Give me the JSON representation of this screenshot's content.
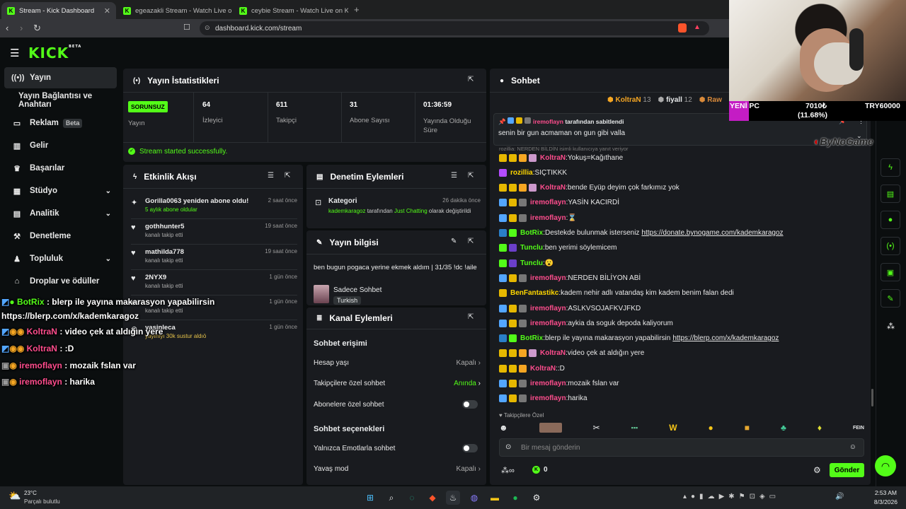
{
  "browser": {
    "tabs": [
      {
        "title": "Stream - Kick Dashboard"
      },
      {
        "title": "egeazakli Stream - Watch Live on"
      },
      {
        "title": "ceybie Stream - Watch Live on K"
      }
    ],
    "url": "dashboard.kick.com/stream"
  },
  "kick": {
    "logo": "KICK",
    "logo_badge": "BETA"
  },
  "sidebar": {
    "items": [
      {
        "label": "Yayın",
        "icon": "broadcast-icon"
      },
      {
        "label": "Yayın Bağlantısı ve Anahtarı"
      },
      {
        "label": "Reklam",
        "badge": "Beta",
        "icon": "tv-icon"
      },
      {
        "label": "Gelir",
        "icon": "chart-icon"
      },
      {
        "label": "Başarılar",
        "icon": "trophy-icon"
      },
      {
        "label": "Stüdyo",
        "icon": "grid-icon"
      },
      {
        "label": "Analitik",
        "icon": "analytics-icon"
      },
      {
        "label": "Denetleme",
        "icon": "hammer-icon"
      },
      {
        "label": "Topluluk",
        "icon": "community-icon"
      },
      {
        "label": "Droplar ve ödüller",
        "icon": "gift-icon"
      }
    ]
  },
  "stats": {
    "title": "Yayın İstatistikleri",
    "health_badge": "SORUNSUZ",
    "health_label": "Yayın",
    "viewers": "64",
    "viewers_label": "İzleyici",
    "followers": "611",
    "followers_label": "Takipçi",
    "subs": "31",
    "subs_label": "Abone Sayısı",
    "uptime": "01:36:59",
    "uptime_label": "Yayında Olduğu Süre",
    "success": "Stream started successfully."
  },
  "activity": {
    "title": "Etkinlik Akışı",
    "items": [
      {
        "name": "Gorilla0063 yeniden abone oldu!",
        "sub": "5 aylık abone oldular",
        "time": "2 saat önce"
      },
      {
        "name": "gothhunter5",
        "sub": "kanalı takip etti",
        "time": "19 saat önce"
      },
      {
        "name": "mathilda778",
        "sub": "kanalı takip etti",
        "time": "19 saat önce"
      },
      {
        "name": "2NYX9",
        "sub": "kanalı takip etti",
        "time": "1 gün önce"
      },
      {
        "name": "",
        "sub": "kanalı takip etti",
        "time": "1 gün önce"
      },
      {
        "name": "yasinleca",
        "sub": "yayınıyı 30k sustur aldıö",
        "time": "1 gün önce"
      }
    ]
  },
  "moderation": {
    "title": "Denetim Eylemleri",
    "item_title": "Kategori",
    "item_time": "26 dakika önce",
    "item_user": "kademkaragoz",
    "item_mid": " tarafından ",
    "item_cat": "Just Chatting",
    "item_tail": " olarak değiştirildi"
  },
  "stream_info": {
    "title": "Yayın bilgisi",
    "stream_title": "ben bugun pogaca yerine ekmek aldım | 31/35 !dc !aile",
    "category": "Sadece Sohbet",
    "language": "Turkish"
  },
  "channel_actions": {
    "title": "Kanal Eylemleri",
    "chat_access": "Sohbet erişimi",
    "rows1": [
      {
        "label": "Hesap yaşı",
        "value": "Kapalı"
      },
      {
        "label": "Takipçilere özel sohbet",
        "value": "Anında"
      },
      {
        "label": "Abonelere özel sohbet",
        "value": ""
      }
    ],
    "chat_options": "Sohbet seçenekleri",
    "rows2": [
      {
        "label": "Yalnızca Emotlarla sohbet",
        "value": ""
      },
      {
        "label": "Yavaş mod",
        "value": "Kapalı"
      }
    ]
  },
  "chat": {
    "title": "Sohbet",
    "top": [
      {
        "name": "KoltraN",
        "count": "13"
      },
      {
        "name": "fiyall",
        "count": "12"
      },
      {
        "name": "Raw",
        "count": ""
      }
    ],
    "pinned_by": "iremoflayn",
    "pinned_label": " tarafından sabitlendi",
    "pinned_text": "senin bir gun acmaman on gun gibi valla",
    "notice": "rozillia: NERDEN BİLDİN isimli kullanıcıya yanıt veriyor",
    "messages": [
      {
        "user": "KoltraN",
        "color": "#ff4d8d",
        "text": "Yokuş=Kağıthane"
      },
      {
        "user": "rozillia",
        "color": "#ffd700",
        "text": "SIÇTIKKK"
      },
      {
        "user": "KoltraN",
        "color": "#ff4d8d",
        "text": "bende Eyüp deyim çok farkımız yok"
      },
      {
        "user": "iremoflayn",
        "color": "#ff4d8d",
        "text": "YASİN KACIRDİ"
      },
      {
        "user": "iremoflayn",
        "color": "#ff4d8d",
        "text": "⌛"
      },
      {
        "user": "BotRix",
        "color": "#53fc18",
        "text": "Destekde bulunmak isterseniz ",
        "link": "https://donate.bynogame.com/kademkaragoz"
      },
      {
        "user": "Tunclu",
        "color": "#53fc18",
        "text": "ben yerimi söylemicem"
      },
      {
        "user": "Tunclu",
        "color": "#53fc18",
        "text": "😮"
      },
      {
        "user": "iremoflayn",
        "color": "#ff4d8d",
        "text": "NERDEN BİLİYON ABİ"
      },
      {
        "user": "BenFantastikc",
        "color": "#ffd700",
        "text": "kadem nehir adlı vatandaş kim kadem benim falan dedi"
      },
      {
        "user": "iremoflayn",
        "color": "#ff4d8d",
        "text": "ASLKVSOJAFKVJFKD"
      },
      {
        "user": "iremoflayn",
        "color": "#ff4d8d",
        "text": "aykia da soguk depoda kaliyorum"
      },
      {
        "user": "BotRix",
        "color": "#53fc18",
        "text": "blerp ile yayına makarasyon yapabilirsin ",
        "link": "https://blerp.com/x/kademkaragoz"
      },
      {
        "user": "KoltraN",
        "color": "#ff4d8d",
        "text": "video çek at aldığın yere"
      },
      {
        "user": "KoltraN",
        "color": "#ff4d8d",
        "text": ":D"
      },
      {
        "user": "iremoflayn",
        "color": "#ff4d8d",
        "text": "mozaik fslan var"
      },
      {
        "user": "iremoflayn",
        "color": "#ff4d8d",
        "text": "harika"
      }
    ],
    "followers_only": "Takipçilere Özel",
    "input_placeholder": "Bir mesaj gönderin",
    "points": "0",
    "send": "Gönder"
  },
  "overlay": {
    "lines": [
      {
        "user": "BotRix",
        "text": " : blerp ile yayına makarasyon yapabilirsin"
      },
      {
        "user": "",
        "text": "https://blerp.com/x/kademkaragoz"
      },
      {
        "user": "KoltraN",
        "text": " : video çek at aldığın yere"
      },
      {
        "user": "KoltraN",
        "text": " : :D"
      },
      {
        "user": "iremoflayn",
        "text": " : mozaik fslan var"
      },
      {
        "user": "iremoflayn",
        "text": " : harika"
      }
    ],
    "ticker_label": "YENİ PC",
    "ticker_amount": "7010₺",
    "ticker_pct": "(11.68%)",
    "ticker_goal": "TRY60000",
    "brand": "ByNoGame"
  },
  "taskbar": {
    "temp": "23°C",
    "weather": "Parçalı bulutlu",
    "time": "2:53 AM",
    "date": "8/3/2026"
  },
  "colors": {
    "accent": "#53fc18",
    "panel": "#191b1f",
    "bg": "#0b0e0f"
  }
}
